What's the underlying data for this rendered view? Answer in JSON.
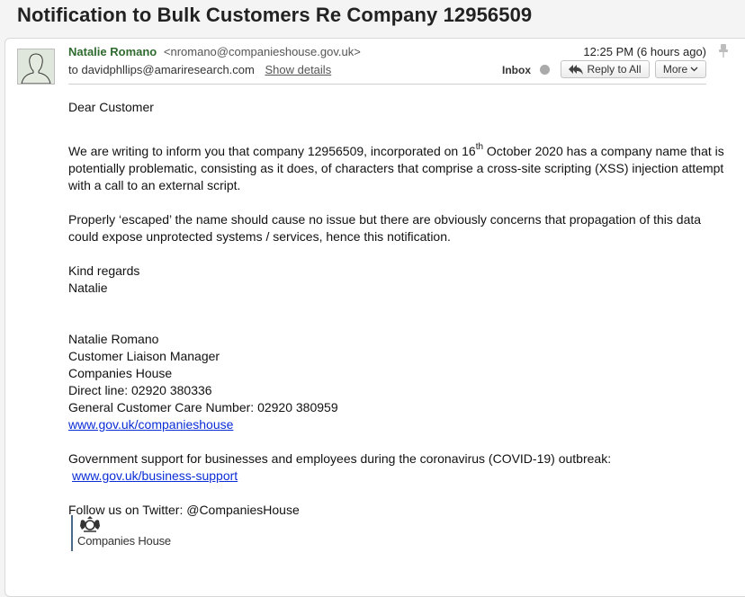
{
  "subject": "Notification to Bulk Customers Re Company 12956509",
  "header": {
    "sender_name": "Natalie Romano",
    "sender_email": "<nromano@companieshouse.gov.uk>",
    "to_prefix": "to",
    "recipient": "davidphllips@amariresearch.com",
    "show_details": "Show details",
    "timestamp": "12:25 PM (6 hours ago)",
    "inbox_label": "Inbox",
    "reply_all_label": "Reply to All",
    "more_label": "More",
    "colors": {
      "sender_name": "#2f6b2f",
      "link": "#0b2dd6"
    }
  },
  "body": {
    "greeting": "Dear Customer",
    "para1_part1": "We are writing to inform you that company 12956509, incorporated on 16",
    "para1_sup": "th",
    "para1_part2": " October 2020 has a company name that is potentially problematic, consisting as it does, of characters that comprise a cross-site scripting (XSS) injection attempt with a call to an external script.",
    "para2": "Properly ‘escaped’ the name should cause no issue but there are obviously concerns that propagation of this data could expose unprotected systems / services, hence this notification.",
    "signoff": "Kind regards",
    "signoff_name": "Natalie",
    "signature": {
      "name": "Natalie Romano",
      "title": "Customer Liaison Manager",
      "org": "Companies House",
      "direct_line": "Direct line: 02920 380336",
      "general_line": "General Customer Care Number: 02920 380959",
      "website": "www.gov.uk/companieshouse"
    },
    "covid_text": "Government support for businesses and employees during the coronavirus (COVID-19) outbreak:",
    "covid_link": "www.gov.uk/business-support",
    "twitter": "Follow us on Twitter: @CompaniesHouse",
    "logo_text": "Companies House"
  }
}
